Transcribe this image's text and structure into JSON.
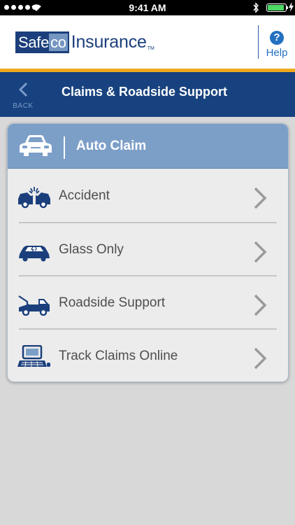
{
  "status_bar": {
    "time": "9:41 AM"
  },
  "header": {
    "logo_part1": "Safe",
    "logo_part2": "co",
    "logo_part3": "Insurance",
    "logo_tm": "TM",
    "help_icon_glyph": "?",
    "help_label": "Help"
  },
  "nav": {
    "back_label": "BACK",
    "title": "Claims & Roadside Support"
  },
  "card": {
    "title": "Auto Claim",
    "items": [
      {
        "label": "Accident",
        "icon": "car-crash-icon"
      },
      {
        "label": "Glass Only",
        "icon": "cracked-windshield-icon"
      },
      {
        "label": "Roadside Support",
        "icon": "tow-truck-icon"
      },
      {
        "label": "Track Claims Online",
        "icon": "computer-icon"
      }
    ]
  },
  "colors": {
    "brand_navy": "#17427f",
    "accent_gold": "#f0a81c",
    "card_header": "#7c9fc8",
    "icon_blue": "#1b3f7c",
    "link_blue": "#2370c0"
  }
}
